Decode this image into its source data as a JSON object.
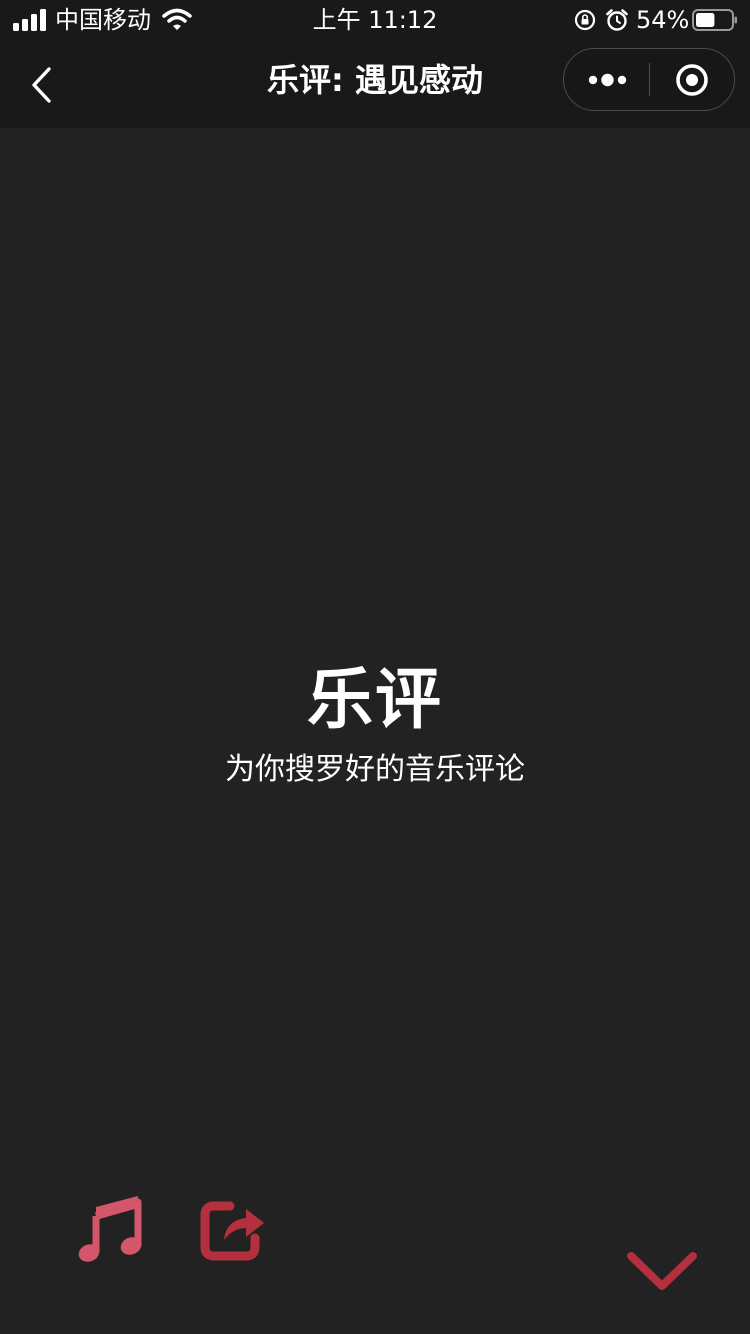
{
  "status_bar": {
    "carrier": "中国移动",
    "time": "上午 11:12",
    "battery_percent": "54%",
    "battery_level": 0.54,
    "icons": [
      "signal-icon",
      "wifi-icon",
      "lock-rotation-icon",
      "alarm-icon",
      "battery-icon"
    ]
  },
  "nav": {
    "title": "乐评: 遇见感动",
    "back_icon": "chevron-left-icon",
    "more_icon": "more-dots-icon",
    "close_icon": "target-close-icon"
  },
  "hero": {
    "title": "乐评",
    "subtitle": "为你搜罗好的音乐评论"
  },
  "actions": {
    "music_icon": "music-note-icon",
    "share_icon": "share-icon",
    "collapse_icon": "chevron-down-icon"
  },
  "colors": {
    "background": "#222222",
    "bar_background": "#191919",
    "music_icon": "#d4566a",
    "share_icon": "#b5303f",
    "chevron": "#b5303f",
    "text": "#ffffff"
  }
}
